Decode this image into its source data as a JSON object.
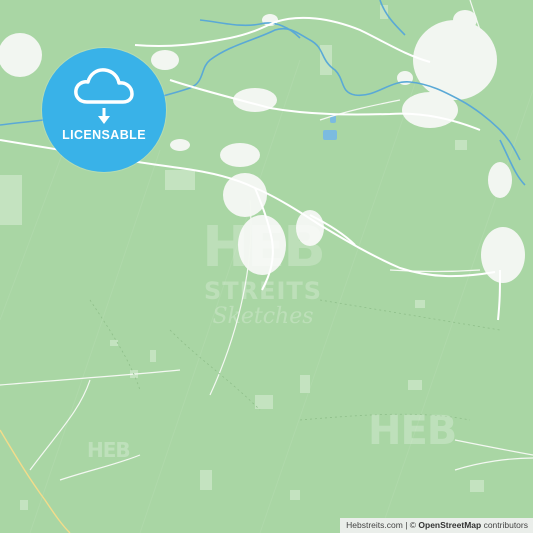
{
  "badge": {
    "label": "LICENSABLE",
    "icon": "cloud-download-icon",
    "color": "#39b2e8"
  },
  "watermark": {
    "brand": "HEB",
    "sub": "STREITS",
    "script": "Sketches"
  },
  "watermark_small": {
    "text": "HEB"
  },
  "attribution": {
    "site": "Hebstreits.com",
    "separator": " | © ",
    "osm": "OpenStreetMap",
    "suffix": " contributors"
  },
  "colors": {
    "land": "#a9d6a4",
    "urban": "#ffffff",
    "water": "#5aa9d6",
    "road": "#ffffff",
    "highway": "#f4dc8a"
  }
}
